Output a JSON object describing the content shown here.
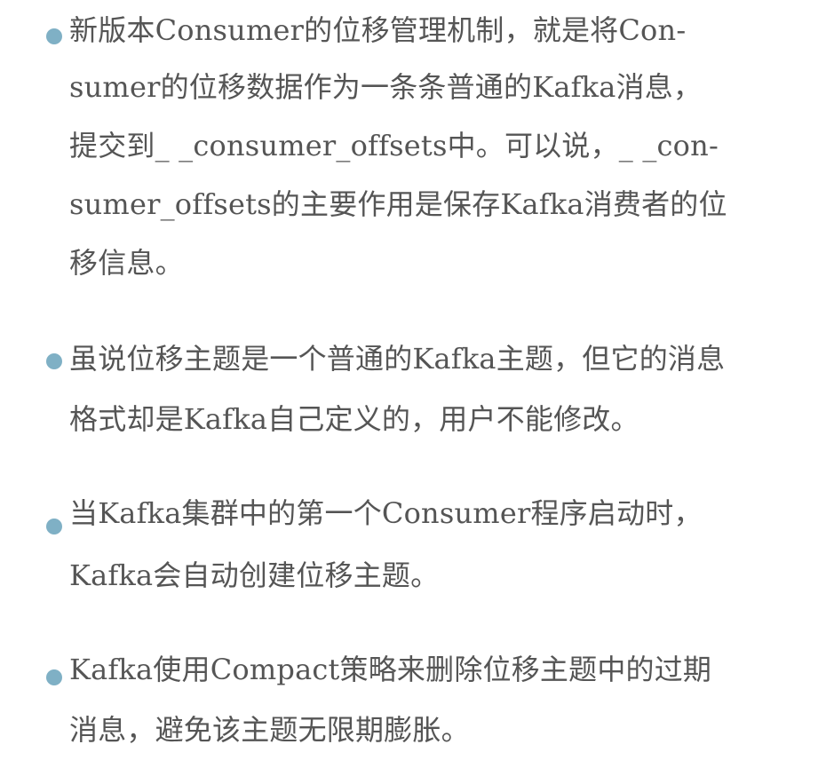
{
  "colors": {
    "bullet": "#7fb0c5",
    "text": "#555555",
    "background": "#ffffff"
  },
  "bullets": [
    {
      "lines": [
        "新版本Consumer的位移管理机制，就是将Con-",
        "sumer的位移数据作为一条条普通的Kafka消息，",
        "提交到_ _consumer_offsets中。可以说，_ _con-",
        "sumer_offsets的主要作用是保存Kafka消费者的位",
        "移信息。"
      ]
    },
    {
      "lines": [
        "虽说位移主题是一个普通的Kafka主题，但它的消息",
        "格式却是Kafka自己定义的，用户不能修改。"
      ]
    },
    {
      "lines": [
        "当Kafka集群中的第一个Consumer程序启动时，",
        "Kafka会自动创建位移主题。"
      ]
    },
    {
      "lines": [
        "Kafka使用Compact策略来删除位移主题中的过期",
        "消息，避免该主题无限期膨胀。"
      ]
    }
  ]
}
